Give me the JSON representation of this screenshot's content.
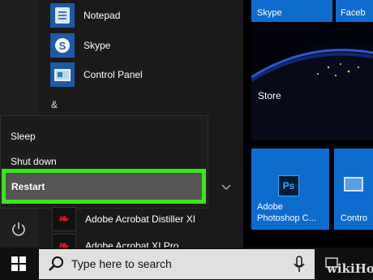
{
  "start_menu": {
    "apps": [
      {
        "label": "Notepad",
        "icon": "notepad-icon"
      },
      {
        "label": "Skype",
        "icon": "skype-icon"
      },
      {
        "label": "Control Panel",
        "icon": "control-panel-icon"
      }
    ],
    "section_letter": "&",
    "pdf_apps": [
      {
        "label": "Adobe Acrobat Distiller XI",
        "icon": "acrobat-distiller-icon"
      },
      {
        "label": "Adobe Acrobat XI Pro",
        "icon": "acrobat-pro-icon"
      }
    ]
  },
  "power_menu": {
    "sleep_label": "Sleep",
    "shutdown_label": "Shut down",
    "restart_label": "Restart",
    "highlight_color": "#39e61c"
  },
  "tiles": {
    "skype": "Skype",
    "facebook": "Faceb",
    "store": "Store",
    "photoshop_line1": "Adobe",
    "photoshop_line2": "Photoshop C...",
    "photoshop_badge": "Ps",
    "control": "Contro",
    "tile_color": "#0f6ccf"
  },
  "taskbar": {
    "search_placeholder": "Type here to search",
    "watermark": "wikiHow"
  }
}
